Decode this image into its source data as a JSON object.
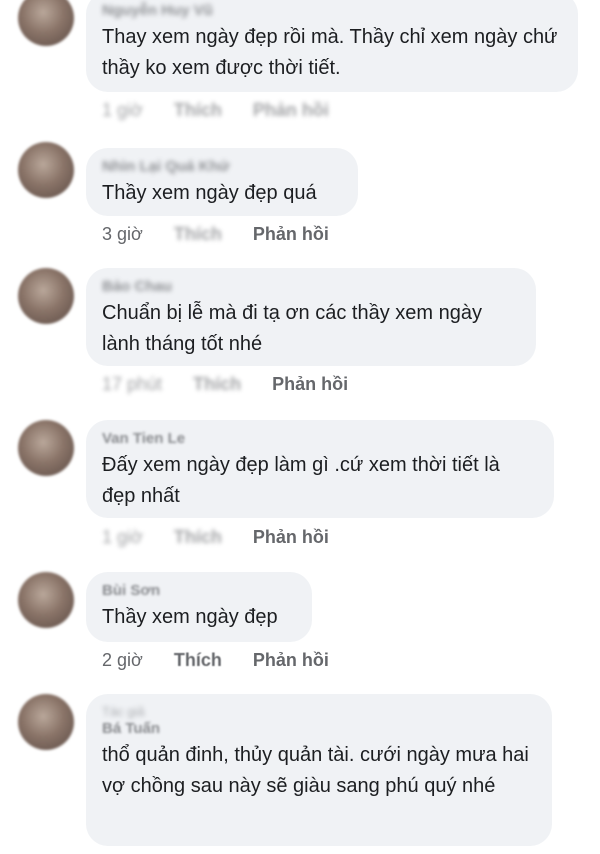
{
  "comments": [
    {
      "name": "Nguyễn Huy Vũ",
      "text": "Thay xem ngày đẹp rồi mà. Thầy chỉ xem ngày chứ thầy ko xem được thời tiết.",
      "time": "1 giờ",
      "like": "Thích",
      "reply": "Phản hồi"
    },
    {
      "name": "Nhìn Lại Quá Khứ",
      "text": "Thầy xem ngày đẹp quá",
      "time": "3 giờ",
      "like": "Thích",
      "reply": "Phản hồi"
    },
    {
      "name": "Bảo Chau",
      "text": "Chuẩn bị lễ mà đi tạ ơn các thầy xem ngày lành tháng tốt nhé",
      "time": "17 phút",
      "like": "Thích",
      "reply": "Phản hồi"
    },
    {
      "name": "Van Tien Le",
      "text": "Đấy xem ngày đẹp làm gì .cứ xem thời tiết là đẹp nhất",
      "time": "1 giờ",
      "like": "Thích",
      "reply": "Phản hồi"
    },
    {
      "name": "Bùi Sơn",
      "text": "Thầy xem ngày đẹp",
      "time": "2 giờ",
      "like": "Thích",
      "reply": "Phản hồi"
    },
    {
      "top_line": "Tác giả",
      "name": "Bá Tuấn",
      "text": "thổ quản đinh, thủy quản tài. cưới ngày mưa hai vợ chồng sau này sẽ giàu sang phú quý nhé"
    }
  ]
}
